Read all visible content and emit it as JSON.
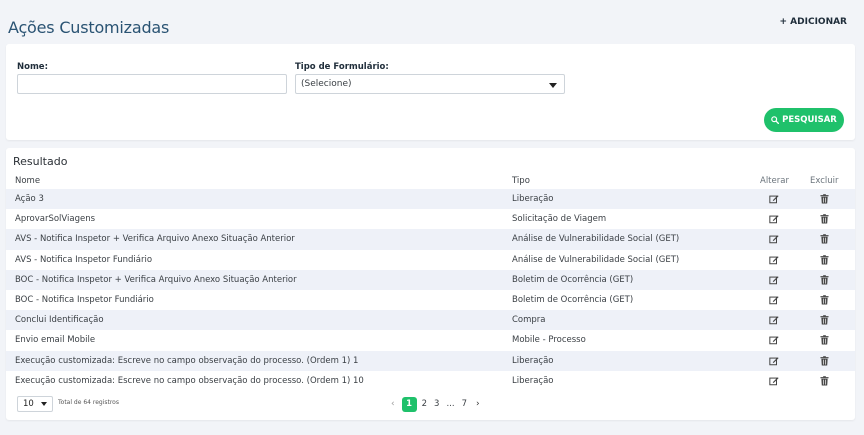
{
  "header": {
    "title": "Ações Customizadas",
    "add_label": "+ ADICIONAR"
  },
  "filters": {
    "name_label": "Nome:",
    "name_value": "",
    "form_type_label": "Tipo de Formulário:",
    "form_type_selected": "(Selecione)",
    "search_label": "PESQUISAR"
  },
  "results": {
    "title": "Resultado",
    "columns": {
      "name": "Nome",
      "type": "Tipo",
      "edit": "Alterar",
      "delete": "Excluir"
    },
    "rows": [
      {
        "name": "Ação 3",
        "type": "Liberação"
      },
      {
        "name": "AprovarSolViagens",
        "type": "Solicitação de Viagem"
      },
      {
        "name": "AVS - Notifica Inspetor + Verifica Arquivo Anexo Situação Anterior",
        "type": "Análise de Vulnerabilidade Social (GET)"
      },
      {
        "name": "AVS - Notifica Inspetor Fundiário",
        "type": "Análise de Vulnerabilidade Social (GET)"
      },
      {
        "name": "BOC - Notifica Inspetor + Verifica Arquivo Anexo Situação Anterior",
        "type": "Boletim de Ocorrência (GET)"
      },
      {
        "name": "BOC - Notifica Inspetor Fundiário",
        "type": "Boletim de Ocorrência (GET)"
      },
      {
        "name": "Conclui Identificação",
        "type": "Compra"
      },
      {
        "name": "Envio email Mobile",
        "type": "Mobile - Processo"
      },
      {
        "name": "Execução customizada: Escreve no campo observação do processo. (Ordem 1) 1",
        "type": "Liberação"
      },
      {
        "name": "Execução customizada: Escreve no campo observação do processo. (Ordem 1) 10",
        "type": "Liberação"
      }
    ],
    "page_size": "10",
    "total_text": "Total de 64 registros",
    "pagination": {
      "prev": "‹",
      "pages": [
        "1",
        "2",
        "3"
      ],
      "ellipsis": "...",
      "last": "7",
      "next": "›",
      "current": "1"
    }
  },
  "colors": {
    "title": "#2a5373",
    "accent": "#1fc16b",
    "row_stripe": "#eef1f8",
    "background": "#f2f4f8"
  },
  "icons": {
    "search": "search-icon",
    "edit": "edit-icon",
    "delete": "trash-icon",
    "dropdown": "chevron-down-icon"
  }
}
